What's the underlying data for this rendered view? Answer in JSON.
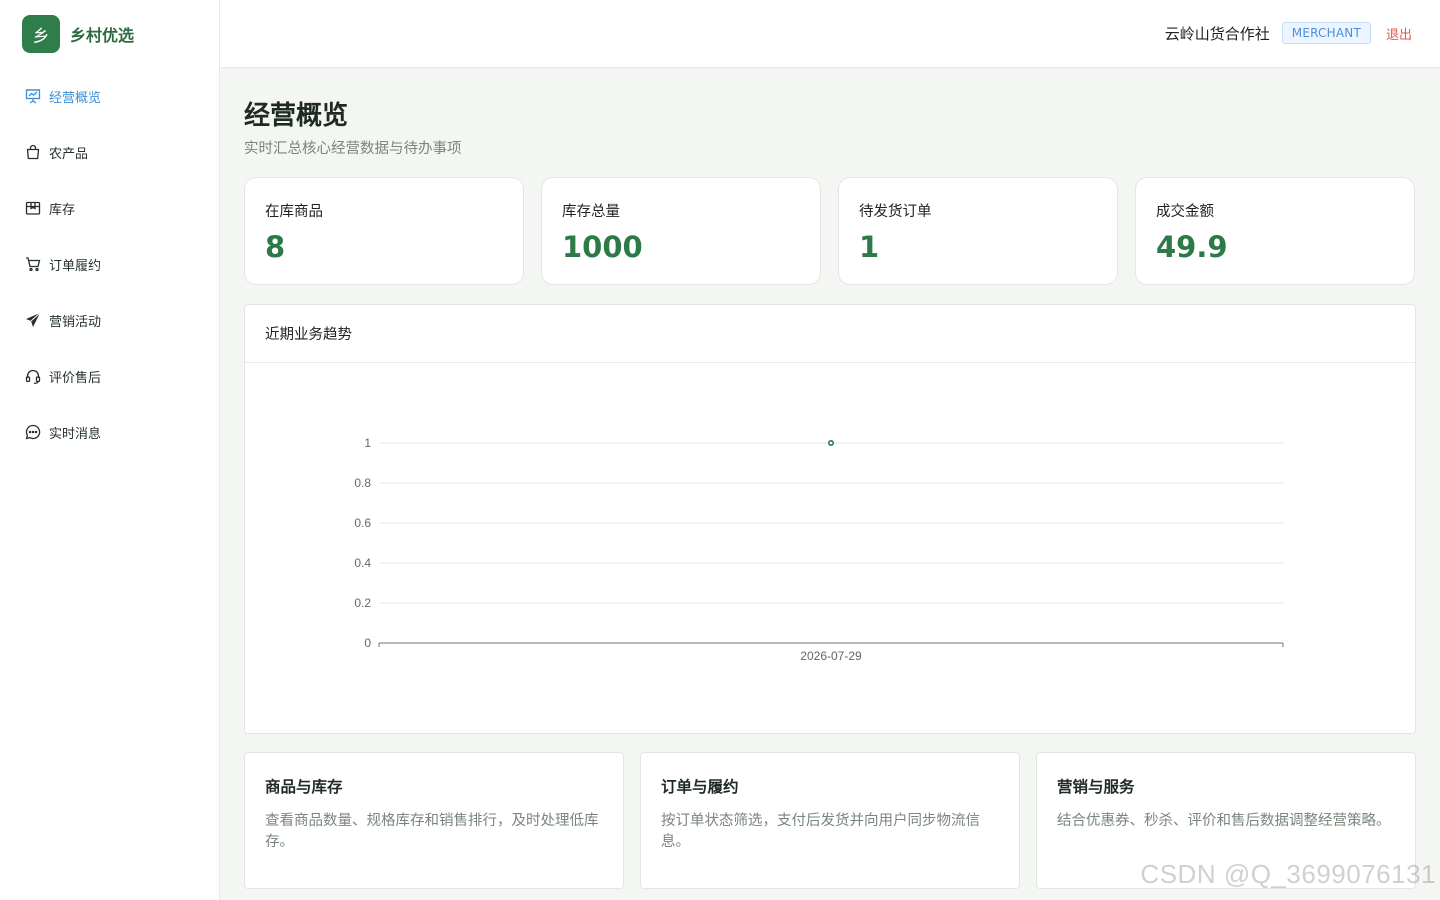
{
  "brand": {
    "logo_char": "乡",
    "name": "乡村优选"
  },
  "sidebar": {
    "items": [
      {
        "label": "经营概览",
        "icon": "presentation-icon",
        "active": true
      },
      {
        "label": "农产品",
        "icon": "bag-icon",
        "active": false
      },
      {
        "label": "库存",
        "icon": "box-icon",
        "active": false
      },
      {
        "label": "订单履约",
        "icon": "cart-icon",
        "active": false
      },
      {
        "label": "营销活动",
        "icon": "send-icon",
        "active": false
      },
      {
        "label": "评价售后",
        "icon": "headset-icon",
        "active": false
      },
      {
        "label": "实时消息",
        "icon": "chat-icon",
        "active": false
      }
    ]
  },
  "header": {
    "coop_name": "云岭山货合作社",
    "role": "MERCHANT",
    "logout": "退出"
  },
  "page": {
    "title": "经营概览",
    "subtitle": "实时汇总核心经营数据与待办事项"
  },
  "stats": [
    {
      "label": "在库商品",
      "value": "8"
    },
    {
      "label": "库存总量",
      "value": "1000"
    },
    {
      "label": "待发货订单",
      "value": "1"
    },
    {
      "label": "成交金额",
      "value": "49.9"
    }
  ],
  "trend": {
    "title": "近期业务趋势"
  },
  "chart_data": {
    "type": "line",
    "categories": [
      "2026-07-29"
    ],
    "series": [
      {
        "values": [
          1
        ]
      }
    ],
    "ylim": [
      0,
      1
    ],
    "yticks": [
      "0",
      "0.2",
      "0.4",
      "0.6",
      "0.8",
      "1"
    ],
    "grid": true
  },
  "cards": [
    {
      "title": "商品与库存",
      "desc": "查看商品数量、规格库存和销售排行，及时处理低库存。"
    },
    {
      "title": "订单与履约",
      "desc": "按订单状态筛选，支付后发货并向用户同步物流信息。"
    },
    {
      "title": "营销与服务",
      "desc": "结合优惠券、秒杀、评价和售后数据调整经营策略。"
    }
  ],
  "watermark": "CSDN @Q_3699076131",
  "colors": {
    "brand": "#2f7d4a",
    "active": "#3a8fd8",
    "value": "#2c7a47",
    "logout": "#e5564f"
  }
}
